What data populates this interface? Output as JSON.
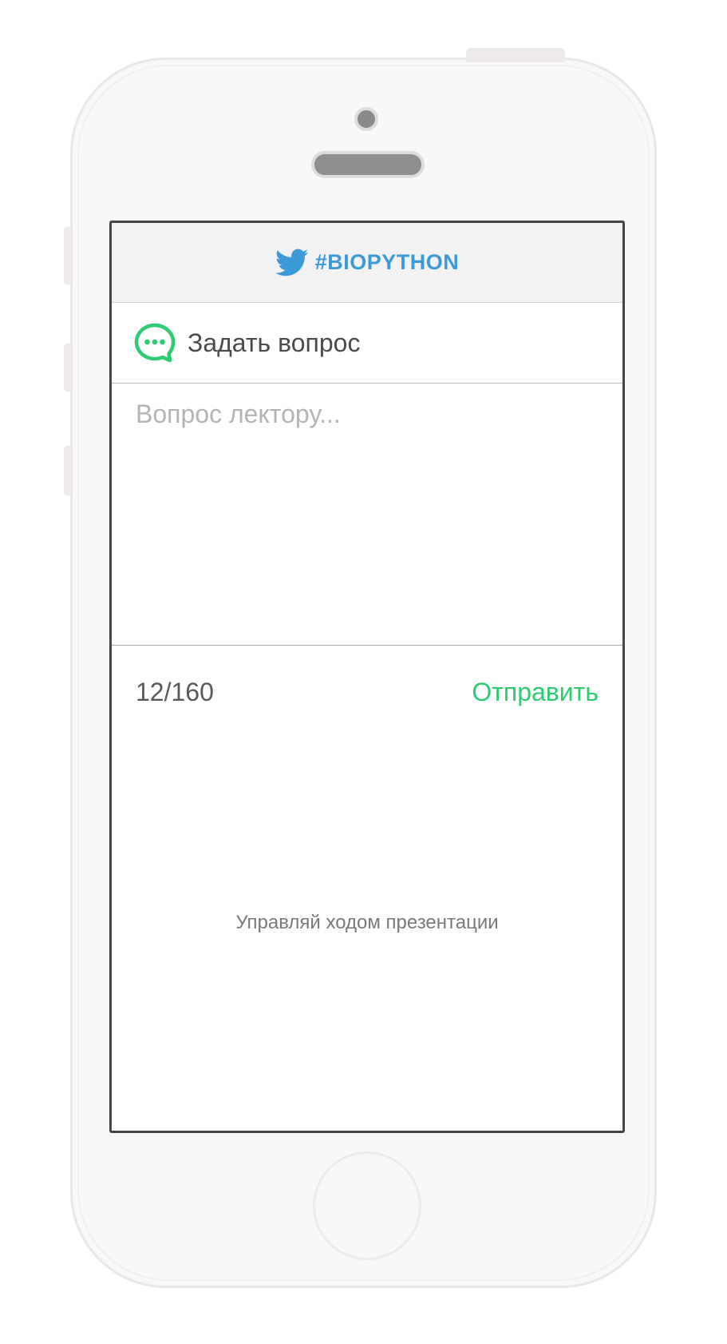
{
  "header": {
    "title": "#BIOPYTHON",
    "icon": "twitter-bird-icon",
    "accent_color": "#3d9ad9"
  },
  "ask": {
    "label": "Задать вопрос",
    "icon": "chat-bubble-icon",
    "icon_color": "#2ecc71"
  },
  "question": {
    "placeholder": "Вопрос лектору...",
    "value": ""
  },
  "footer": {
    "counter": "12/160",
    "send_label": "Отправить",
    "send_color": "#2ecc71"
  },
  "hint": "Управляй ходом презентации"
}
